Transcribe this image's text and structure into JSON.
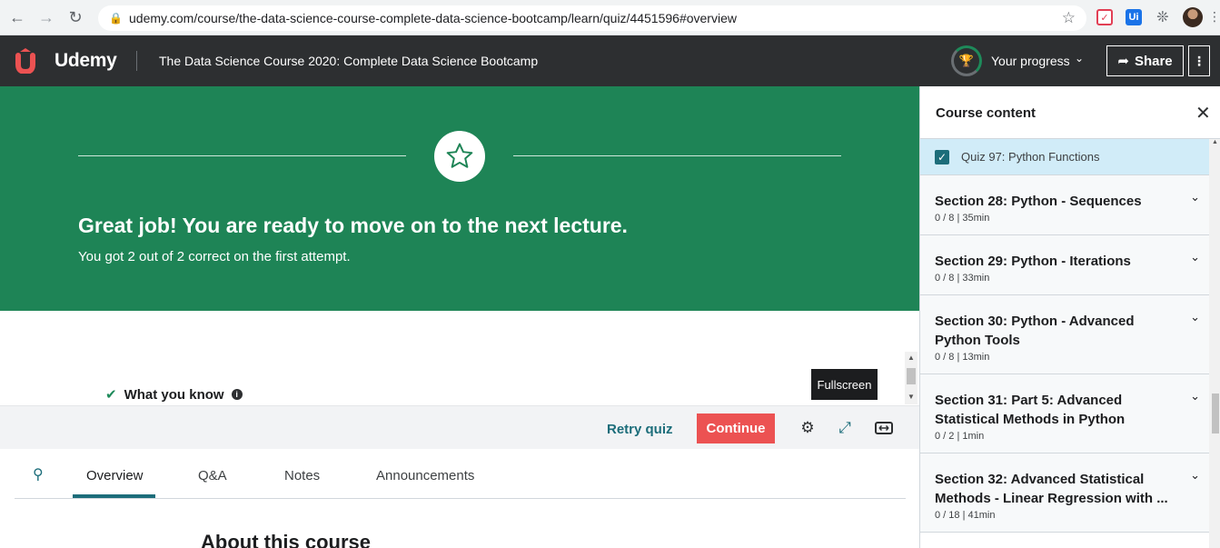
{
  "browser": {
    "url": "udemy.com/course/the-data-science-course-complete-data-science-bootcamp/learn/quiz/4451596#overview",
    "extension_ui": "Ui"
  },
  "header": {
    "logo_text": "Udemy",
    "course_title": "The Data Science Course 2020: Complete Data Science Bootcamp",
    "progress_label": "Your progress",
    "share_label": "Share",
    "colors": {
      "background": "#2d2f31",
      "progress_ring": "#1e8a5a"
    }
  },
  "banner": {
    "title": "Great job! You are ready to move on to the next lecture.",
    "subtitle": "You got 2 out of 2 correct on the first attempt.",
    "color": "#1e8456"
  },
  "results": {
    "what_you_know": "What you know"
  },
  "quiz_footer": {
    "retry_label": "Retry quiz",
    "continue_label": "Continue",
    "tooltip": "Fullscreen",
    "continue_color": "#ec5252"
  },
  "tabs": {
    "items": [
      "Overview",
      "Q&A",
      "Notes",
      "Announcements"
    ],
    "active": "Overview"
  },
  "main": {
    "about_heading": "About this course"
  },
  "sidebar": {
    "title": "Course content",
    "current_item": {
      "label": "Quiz 97: Python Functions",
      "checked": true
    },
    "sections": [
      {
        "title": "Section 28: Python - Sequences",
        "meta": "0 / 8 | 35min"
      },
      {
        "title": "Section 29: Python - Iterations",
        "meta": "0 / 8 | 33min"
      },
      {
        "title": "Section 30: Python - Advanced Python Tools",
        "meta": "0 / 8 | 13min"
      },
      {
        "title": "Section 31: Part 5: Advanced Statistical Methods in Python",
        "meta": "0 / 2 | 1min"
      },
      {
        "title": "Section 32: Advanced Statistical Methods - Linear Regression with ...",
        "meta": "0 / 18 | 41min"
      }
    ]
  }
}
